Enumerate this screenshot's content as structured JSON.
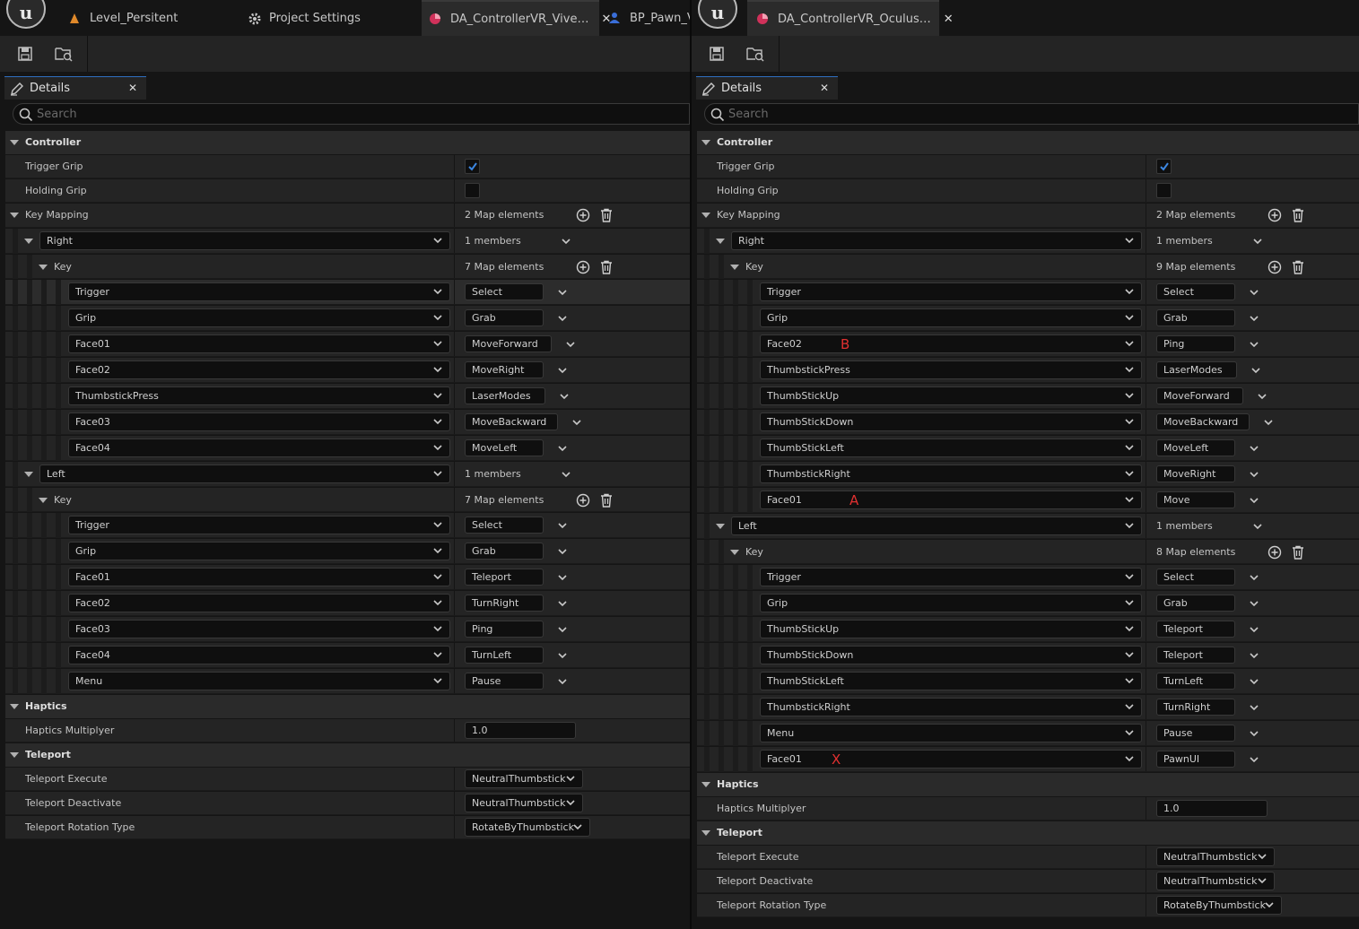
{
  "left": {
    "tabs": [
      {
        "label": "Level_Persitent",
        "icon": "level-icon"
      },
      {
        "label": "Project Settings",
        "icon": "settings-icon"
      },
      {
        "label": "DA_ControllerVR_Vive…",
        "icon": "data-asset-icon",
        "active": true
      },
      {
        "label": "BP_Pawn_V",
        "icon": "pawn-icon"
      }
    ],
    "details_tab": "Details",
    "search_placeholder": "Search",
    "controller": {
      "title": "Controller",
      "trigger_grip": "Trigger Grip",
      "holding_grip": "Holding Grip",
      "key_mapping": "Key Mapping",
      "key_mapping_count": "2 Map elements",
      "groups": [
        {
          "name": "Right",
          "members": "1 members",
          "key_label": "Key",
          "key_count": "7 Map elements",
          "entries": [
            {
              "key": "Trigger",
              "value": "Select"
            },
            {
              "key": "Grip",
              "value": "Grab"
            },
            {
              "key": "Face01",
              "value": "MoveForward"
            },
            {
              "key": "Face02",
              "value": "MoveRight"
            },
            {
              "key": "ThumbstickPress",
              "value": "LaserModes"
            },
            {
              "key": "Face03",
              "value": "MoveBackward"
            },
            {
              "key": "Face04",
              "value": "MoveLeft"
            }
          ]
        },
        {
          "name": "Left",
          "members": "1 members",
          "key_label": "Key",
          "key_count": "7 Map elements",
          "entries": [
            {
              "key": "Trigger",
              "value": "Select"
            },
            {
              "key": "Grip",
              "value": "Grab"
            },
            {
              "key": "Face01",
              "value": "Teleport"
            },
            {
              "key": "Face02",
              "value": "TurnRight"
            },
            {
              "key": "Face03",
              "value": "Ping"
            },
            {
              "key": "Face04",
              "value": "TurnLeft"
            },
            {
              "key": "Menu",
              "value": "Pause"
            }
          ]
        }
      ]
    },
    "haptics": {
      "title": "Haptics",
      "multiplyer_label": "Haptics Multiplyer",
      "multiplyer_value": "1.0"
    },
    "teleport": {
      "title": "Teleport",
      "execute_label": "Teleport Execute",
      "execute_value": "NeutralThumbstick",
      "deactivate_label": "Teleport Deactivate",
      "deactivate_value": "NeutralThumbstick",
      "rotation_label": "Teleport Rotation Type",
      "rotation_value": "RotateByThumbstick"
    }
  },
  "right": {
    "tabs": [
      {
        "label": "DA_ControllerVR_Oculus…",
        "icon": "data-asset-icon",
        "active": true
      }
    ],
    "details_tab": "Details",
    "search_placeholder": "Search",
    "controller": {
      "title": "Controller",
      "trigger_grip": "Trigger Grip",
      "holding_grip": "Holding Grip",
      "key_mapping": "Key Mapping",
      "key_mapping_count": "2 Map elements",
      "groups": [
        {
          "name": "Right",
          "members": "1 members",
          "key_label": "Key",
          "key_count": "9 Map elements",
          "entries": [
            {
              "key": "Trigger",
              "value": "Select"
            },
            {
              "key": "Grip",
              "value": "Grab"
            },
            {
              "key": "Face02",
              "value": "Ping",
              "mark": "B"
            },
            {
              "key": "ThumbstickPress",
              "value": "LaserModes"
            },
            {
              "key": "ThumbStickUp",
              "value": "MoveForward"
            },
            {
              "key": "ThumbStickDown",
              "value": "MoveBackward"
            },
            {
              "key": "ThumbStickLeft",
              "value": "MoveLeft"
            },
            {
              "key": "ThumbstickRight",
              "value": "MoveRight"
            },
            {
              "key": "Face01",
              "value": "Move",
              "mark": "A"
            }
          ]
        },
        {
          "name": "Left",
          "members": "1 members",
          "key_label": "Key",
          "key_count": "8 Map elements",
          "entries": [
            {
              "key": "Trigger",
              "value": "Select"
            },
            {
              "key": "Grip",
              "value": "Grab"
            },
            {
              "key": "ThumbStickUp",
              "value": "Teleport"
            },
            {
              "key": "ThumbStickDown",
              "value": "Teleport"
            },
            {
              "key": "ThumbStickLeft",
              "value": "TurnLeft"
            },
            {
              "key": "ThumbstickRight",
              "value": "TurnRight"
            },
            {
              "key": "Menu",
              "value": "Pause"
            },
            {
              "key": "Face01",
              "value": "PawnUI",
              "mark": "X"
            }
          ]
        }
      ]
    },
    "haptics": {
      "title": "Haptics",
      "multiplyer_label": "Haptics Multiplyer",
      "multiplyer_value": "1.0"
    },
    "teleport": {
      "title": "Teleport",
      "execute_label": "Teleport Execute",
      "execute_value": "NeutralThumbstick",
      "deactivate_label": "Teleport Deactivate",
      "deactivate_value": "NeutralThumbstick",
      "rotation_label": "Teleport Rotation Type",
      "rotation_value": "RotateByThumbstick"
    }
  },
  "colors": {
    "accent": "#2f6fc0",
    "checkbox_check": "#3c86e0",
    "annotation": "#e03030"
  }
}
